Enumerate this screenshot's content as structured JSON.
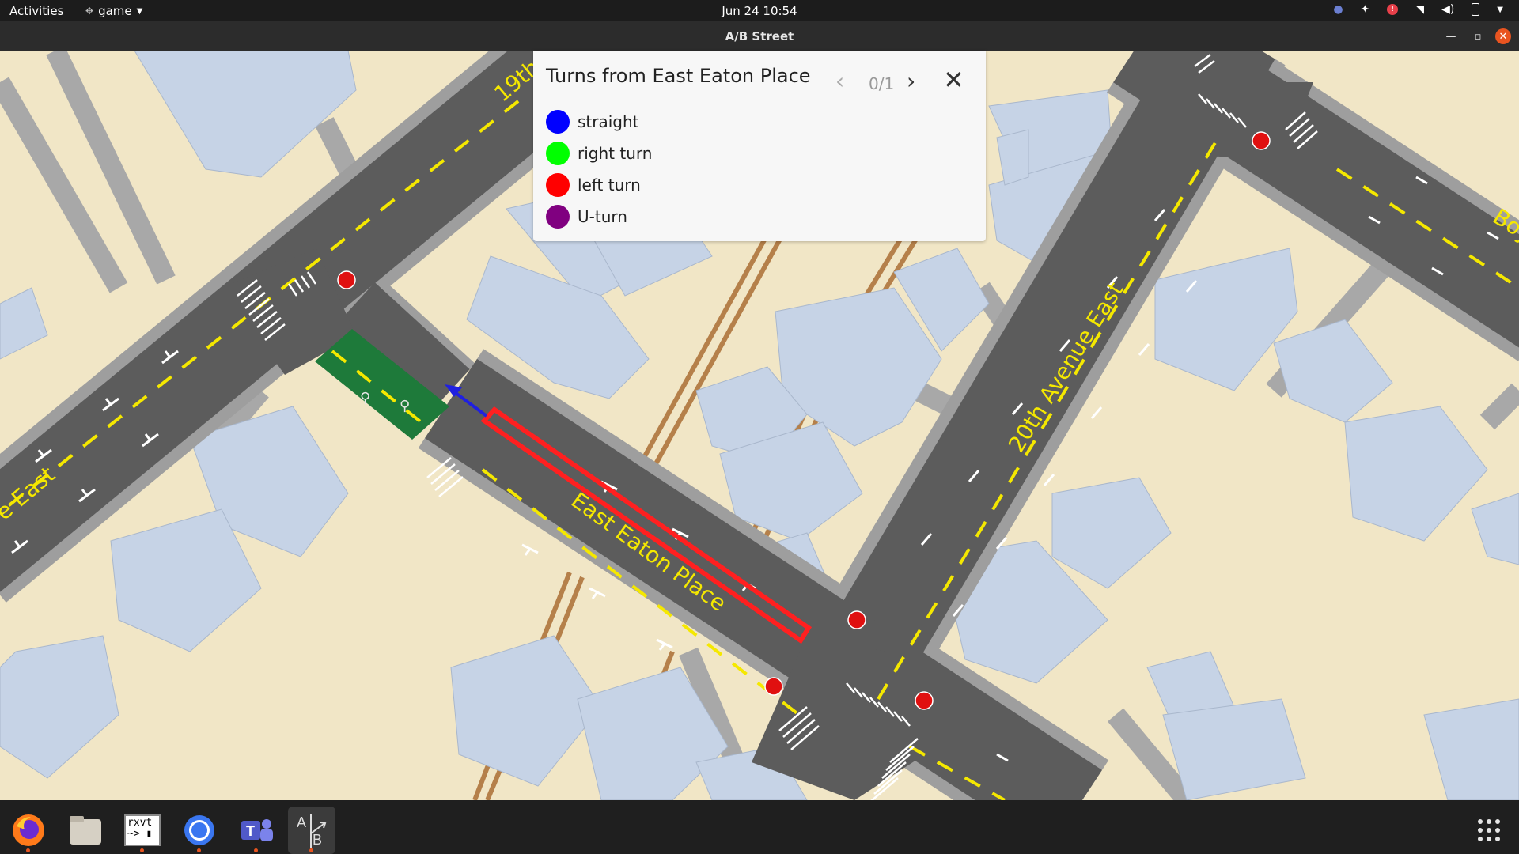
{
  "topbar": {
    "activities": "Activities",
    "app_menu": "game",
    "clock": "Jun 24  10:54"
  },
  "window": {
    "title": "A/B Street"
  },
  "panel": {
    "title": "Turns from East Eaton Place",
    "pager": "0/1",
    "legend": [
      {
        "label": "straight",
        "color": "#0000ff"
      },
      {
        "label": "right turn",
        "color": "#00ff00"
      },
      {
        "label": "left turn",
        "color": "#ff0000"
      },
      {
        "label": "U-turn",
        "color": "#800080"
      }
    ]
  },
  "map": {
    "road_labels": {
      "nineteenth": "19th",
      "east_fragment": "e East",
      "east_eaton": "East Eaton Place",
      "twentieth": "20th Avenue East",
      "boy": "Boy"
    },
    "colors": {
      "ground": "#f1e6c6",
      "building": "#c6d3e6",
      "road": "#5c5c5c",
      "sidewalk": "#a8a8a8",
      "center_line": "#f5e800",
      "bike_lane": "#1e7a3a",
      "highlight": "#ff2020",
      "rail": "#b5804a"
    }
  },
  "dock": {
    "items": [
      "firefox-icon",
      "files-icon",
      "terminal-icon",
      "signal-icon",
      "teams-icon",
      "abstreet-icon"
    ],
    "terminal_text": "rxvt"
  }
}
